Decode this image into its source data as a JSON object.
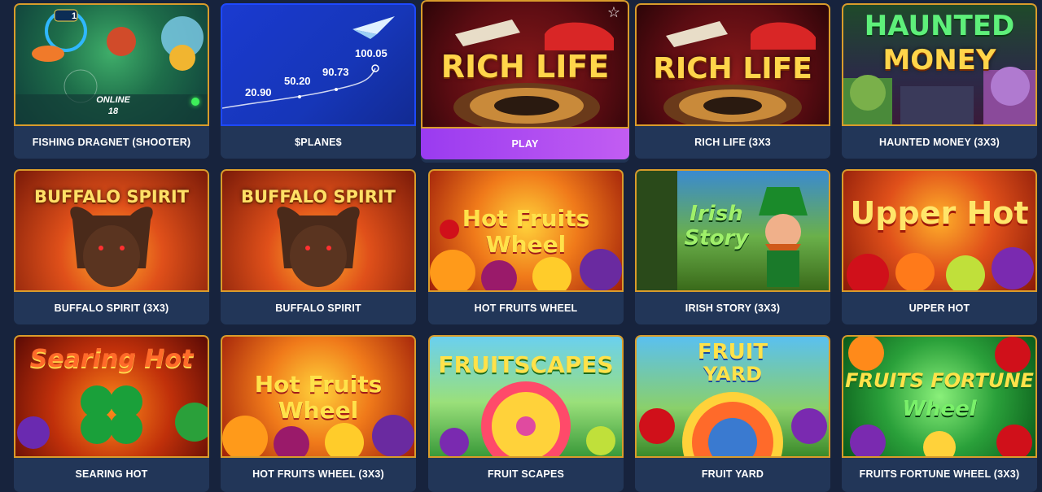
{
  "games": [
    {
      "label": "FISHING DRAGNET (SHOOTER)",
      "online_label": "ONLINE",
      "online_count": "18",
      "badge": "1"
    },
    {
      "label": "$PLANE$",
      "points": [
        "20.90",
        "50.20",
        "90.73",
        "100.05"
      ]
    },
    {
      "label": "PLAY",
      "art_title": "RICH LIFE",
      "active": true
    },
    {
      "label": "RICH LIFE (3X3",
      "art_title": "RICH LIFE"
    },
    {
      "label": "HAUNTED MONEY (3X3)",
      "art_title_1": "HAUNTED",
      "art_title_2": "MONEY"
    },
    {
      "label": "BUFFALO SPIRIT (3X3)",
      "art_title": "BUFFALO SPIRIT"
    },
    {
      "label": "BUFFALO SPIRIT",
      "art_title": "BUFFALO SPIRIT"
    },
    {
      "label": "HOT FRUITS WHEEL",
      "art_title_1": "Hot Fruits",
      "art_title_2": "Wheel"
    },
    {
      "label": "IRISH STORY (3X3)",
      "art_title_1": "Irish",
      "art_title_2": "Story"
    },
    {
      "label": "UPPER HOT",
      "art_title": "Upper Hot"
    },
    {
      "label": "SEARING HOT",
      "art_title": "Searing Hot"
    },
    {
      "label": "HOT FRUITS WHEEL (3X3)",
      "art_title_1": "Hot Fruits",
      "art_title_2": "Wheel"
    },
    {
      "label": "FRUIT SCAPES",
      "art_title": "FRUITSCAPES"
    },
    {
      "label": "FRUIT YARD",
      "art_title_1": "FRUIT",
      "art_title_2": "YARD"
    },
    {
      "label": "FRUITS FORTUNE WHEEL (3X3)",
      "art_title_1": "FRUITS FORTUNE",
      "art_title_2": "Wheel"
    }
  ],
  "colors": {
    "background": "#17233d",
    "card_label_bg": "#223658",
    "thumb_border": "#d99c2b",
    "play_gradient_start": "#9a3bf0",
    "play_gradient_end": "#c25df2"
  }
}
